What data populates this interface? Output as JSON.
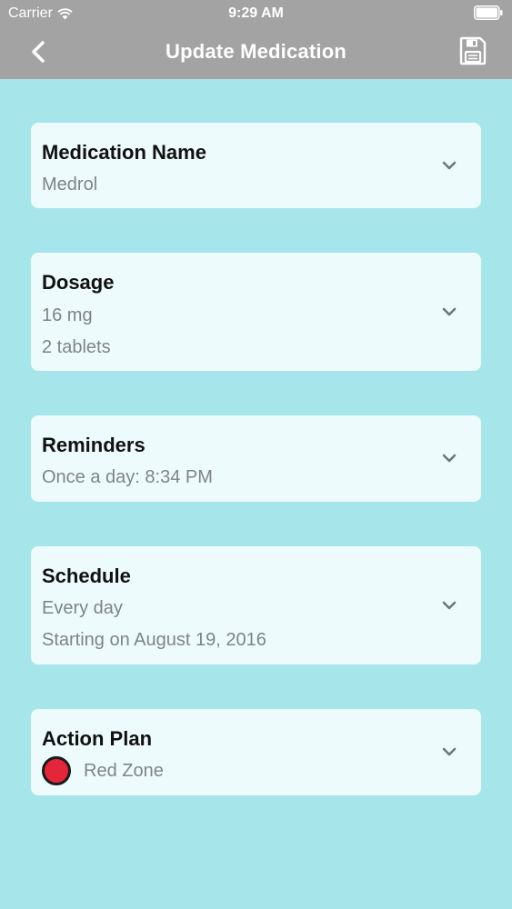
{
  "status_bar": {
    "carrier": "Carrier",
    "time": "9:29 AM"
  },
  "nav": {
    "title": "Update Medication",
    "back_icon": "chevron-left-icon",
    "save_icon": "floppy-disk-icon"
  },
  "colors": {
    "background": "#a6e6ea",
    "header": "#a3a3a3",
    "card": "#eefbfc",
    "zone_red": "#e4263b"
  },
  "cards": {
    "medication": {
      "title": "Medication Name",
      "value": "Medrol"
    },
    "dosage": {
      "title": "Dosage",
      "amount": "16 mg",
      "count": "2 tablets"
    },
    "reminders": {
      "title": "Reminders",
      "value": "Once a day: 8:34 PM"
    },
    "schedule": {
      "title": "Schedule",
      "frequency": "Every day",
      "start": "Starting on August 19, 2016"
    },
    "action_plan": {
      "title": "Action Plan",
      "zone": "Red Zone"
    }
  }
}
